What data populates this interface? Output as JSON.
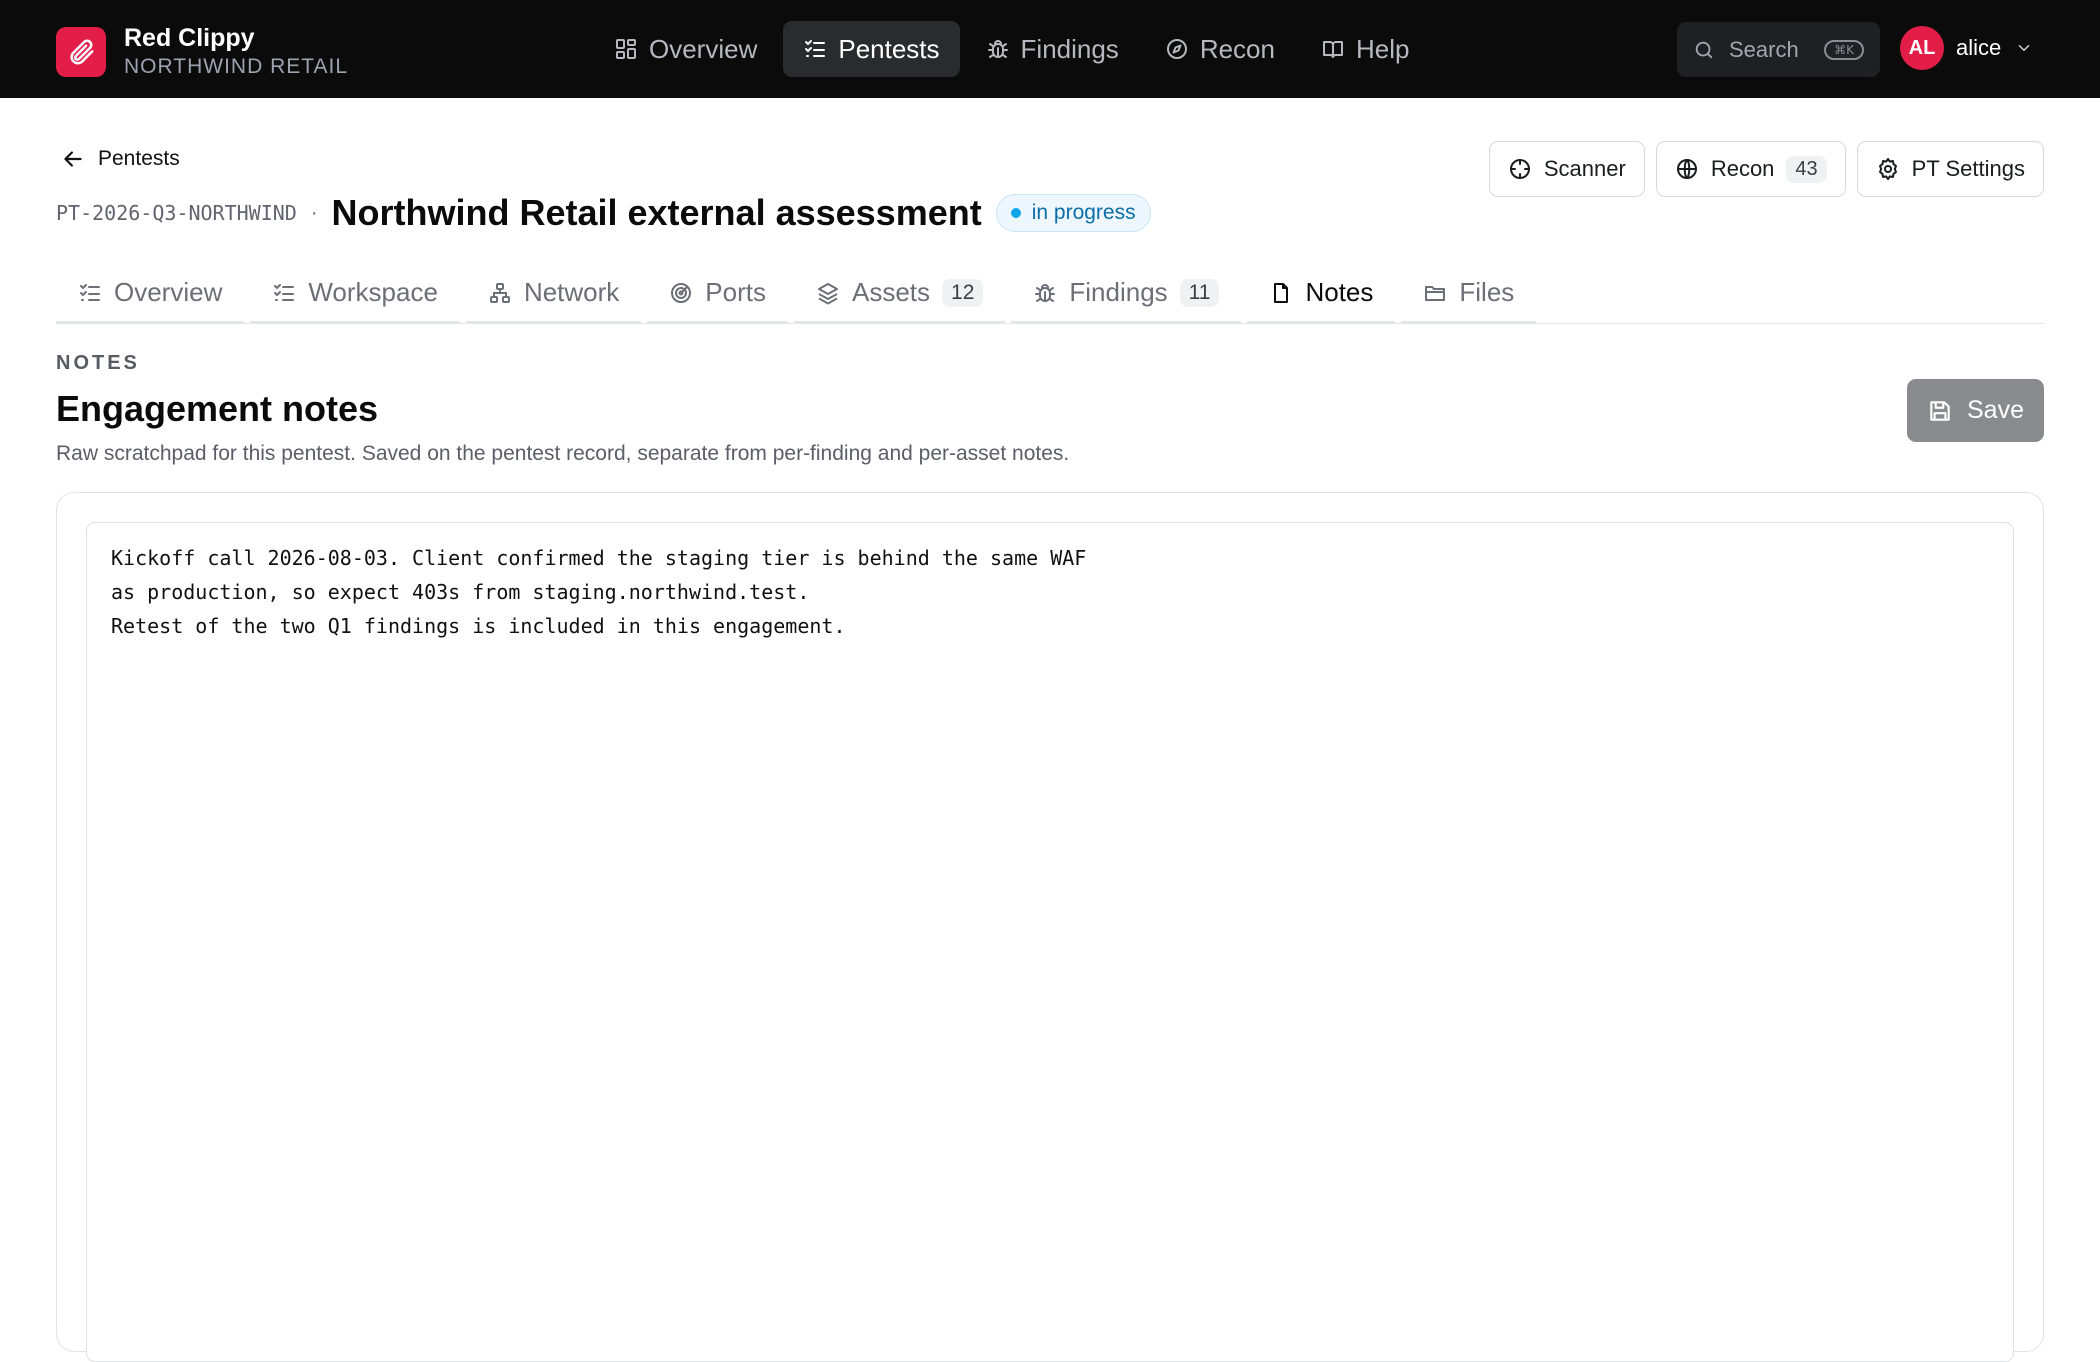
{
  "brand": {
    "name": "Red Clippy",
    "org": "NORTHWIND RETAIL"
  },
  "nav": [
    {
      "label": "Overview",
      "icon": "grid-icon",
      "active": false
    },
    {
      "label": "Pentests",
      "icon": "checklist-icon",
      "active": true
    },
    {
      "label": "Findings",
      "icon": "bug-icon",
      "active": false
    },
    {
      "label": "Recon",
      "icon": "compass-icon",
      "active": false
    },
    {
      "label": "Help",
      "icon": "book-icon",
      "active": false
    }
  ],
  "search": {
    "placeholder": "Search",
    "shortcut": "⌘K"
  },
  "user": {
    "initials": "AL",
    "name": "alice"
  },
  "header": {
    "back_label": "Pentests",
    "pentest_id": "PT-2026-Q3-NORTHWIND",
    "separator": "·",
    "title": "Northwind Retail external assessment",
    "status": "in progress"
  },
  "actions": {
    "scanner": "Scanner",
    "recon": "Recon",
    "recon_count": "43",
    "settings": "PT Settings"
  },
  "tabs": [
    {
      "label": "Overview",
      "icon": "checklist-icon"
    },
    {
      "label": "Workspace",
      "icon": "checklist-icon"
    },
    {
      "label": "Network",
      "icon": "network-icon"
    },
    {
      "label": "Ports",
      "icon": "radar-icon"
    },
    {
      "label": "Assets",
      "icon": "layers-icon",
      "count": "12"
    },
    {
      "label": "Findings",
      "icon": "bug-icon",
      "count": "11"
    },
    {
      "label": "Notes",
      "icon": "file-icon",
      "active": true
    },
    {
      "label": "Files",
      "icon": "folder-icon"
    }
  ],
  "notes": {
    "section_label": "NOTES",
    "title": "Engagement notes",
    "description": "Raw scratchpad for this pentest. Saved on the pentest record, separate from per-finding and per-asset notes.",
    "save_label": "Save",
    "lines": [
      "Kickoff call 2026-08-03. Client confirmed the staging tier is behind the same WAF",
      "as production, so expect 403s from staging.northwind.test.",
      "Retest of the two Q1 findings is included in this engagement."
    ]
  },
  "colors": {
    "brand": "#e11d48",
    "topbar": "#0b0b0c",
    "status": "#0ea5e9"
  }
}
